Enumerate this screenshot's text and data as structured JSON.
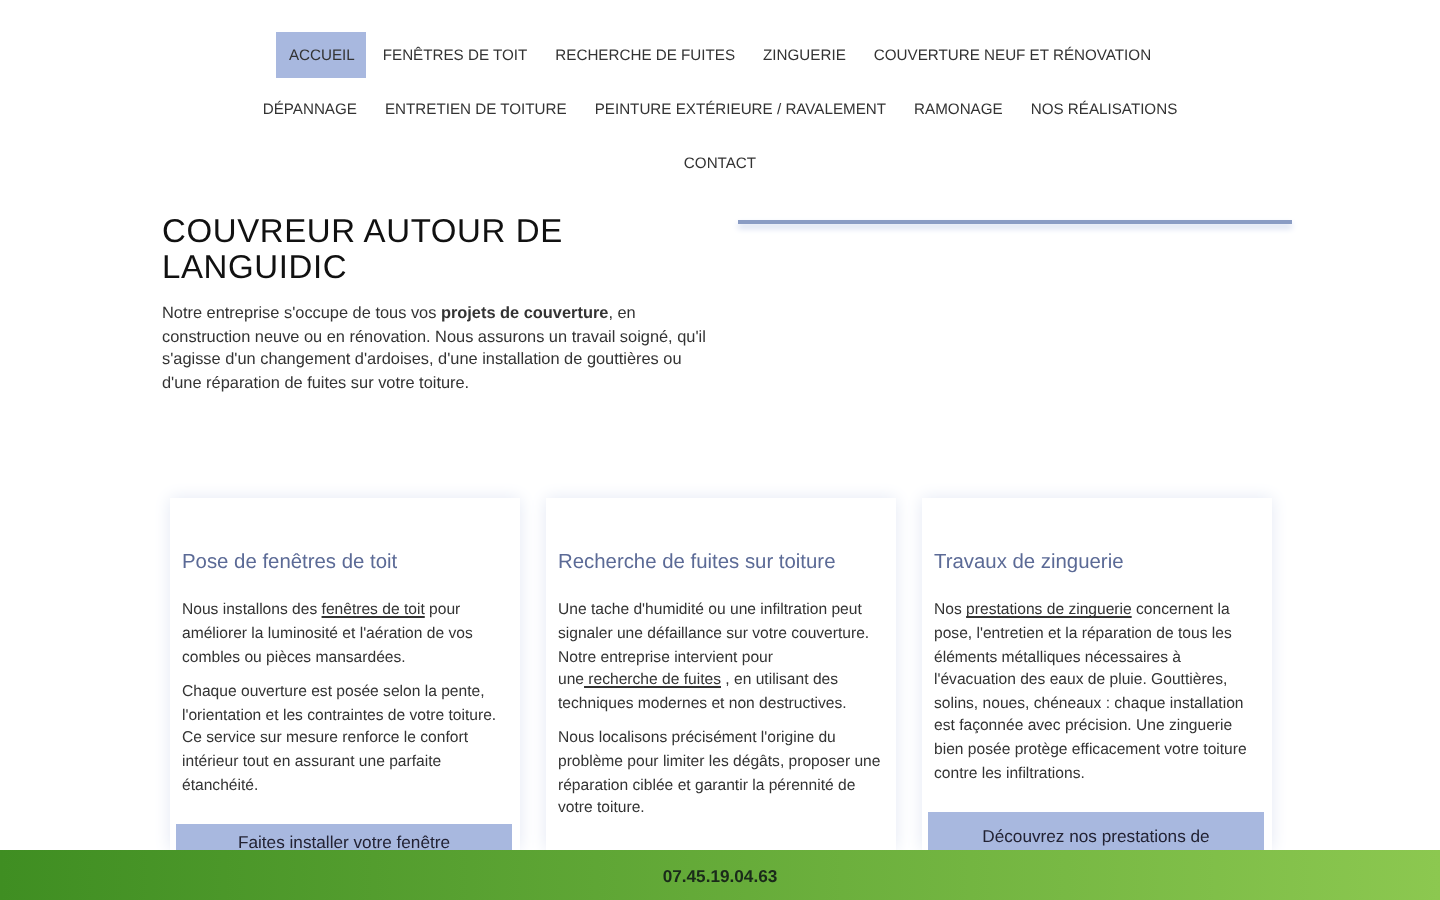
{
  "nav": {
    "items": [
      {
        "label": "ACCUEIL",
        "selected": true
      },
      {
        "label": "FENÊTRES DE TOIT",
        "selected": false
      },
      {
        "label": "RECHERCHE DE FUITES",
        "selected": false
      },
      {
        "label": "ZINGUERIE",
        "selected": false
      },
      {
        "label": "COUVERTURE NEUF ET RÉNOVATION",
        "selected": false
      },
      {
        "label": "DÉPANNAGE",
        "selected": false
      },
      {
        "label": "ENTRETIEN DE TOITURE",
        "selected": false
      },
      {
        "label": "PEINTURE EXTÉRIEURE / RAVALEMENT",
        "selected": false
      },
      {
        "label": "RAMONAGE",
        "selected": false
      },
      {
        "label": "NOS RÉALISATIONS",
        "selected": false
      },
      {
        "label": "CONTACT",
        "selected": false
      }
    ]
  },
  "hero": {
    "title": "COUVREUR AUTOUR DE LANGUIDIC",
    "text": "Notre entreprise s'occupe de tous vos **projets de couverture**, en construction neuve ou en rénovation. Nous assurons un travail soigné, qu'il s'agisse d'un changement d'ardoises, d'une installation de gouttières ou d'une réparation de fuites sur votre toiture."
  },
  "cards": [
    {
      "title": "Pose de fenêtres de toit",
      "paragraphs": [
        [
          {
            "kind": "text",
            "text": "Nous installons des "
          },
          {
            "kind": "link",
            "text": "fenêtres de toit"
          },
          {
            "kind": "text",
            "text": "  pour améliorer la luminosité et l'aération de vos combles ou pièces mansardées."
          }
        ],
        [
          {
            "kind": "text",
            "text": "Chaque ouverture est posée selon la pente, l'orientation et les contraintes de votre toiture. Ce service sur mesure renforce le confort intérieur tout en assurant une parfaite étanchéité."
          }
        ]
      ],
      "button": "Faites installer votre fenêtre"
    },
    {
      "title": "Recherche de fuites sur toiture",
      "paragraphs": [
        [
          {
            "kind": "text",
            "text": "Une tache d'humidité ou une infiltration peut signaler une défaillance sur votre couverture. Notre entreprise intervient pour une"
          },
          {
            "kind": "link",
            "text": " recherche de fuites"
          },
          {
            "kind": "text",
            "text": " , en utilisant des techniques modernes et non destructives."
          }
        ],
        [
          {
            "kind": "text",
            "text": "Nous localisons précisément l'origine du problème pour limiter les dégâts, proposer une réparation ciblée et garantir la pérennité de votre toiture."
          }
        ]
      ]
    },
    {
      "title": "Travaux de zinguerie",
      "paragraphs": [
        [
          {
            "kind": "text",
            "text": "Nos "
          },
          {
            "kind": "link",
            "text": "prestations de zinguerie"
          },
          {
            "kind": "text",
            "text": " concernent la pose, l'entretien et la réparation de tous les éléments métalliques nécessaires à l'évacuation des eaux de pluie. Gouttières, solins, noues, chéneaux : chaque installation est façonnée avec précision. Une zinguerie bien posée protège efficacement votre toiture contre les infiltrations."
          }
        ]
      ],
      "button": "Découvrez nos prestations de"
    }
  ],
  "phone_bar": {
    "phone": "07.45.19.04.63"
  }
}
